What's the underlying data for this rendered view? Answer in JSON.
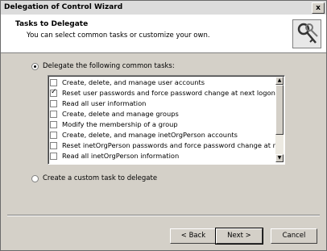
{
  "window": {
    "title": "Delegation of Control Wizard",
    "close": "x"
  },
  "header": {
    "title": "Tasks to Delegate",
    "subtitle": "You can select common tasks or customize your own."
  },
  "options": {
    "delegate_common": "Delegate the following common tasks:",
    "custom": "Create a custom task to delegate"
  },
  "tasks": [
    {
      "label": "Create, delete, and manage user accounts",
      "checked": false
    },
    {
      "label": "Reset user passwords and force password change at next logon",
      "checked": true
    },
    {
      "label": "Read all user information",
      "checked": false
    },
    {
      "label": "Create, delete and manage groups",
      "checked": false
    },
    {
      "label": "Modify the membership of a group",
      "checked": false
    },
    {
      "label": "Create, delete, and manage inetOrgPerson accounts",
      "checked": false
    },
    {
      "label": "Reset inetOrgPerson passwords and force password change at ne...",
      "checked": false
    },
    {
      "label": "Read all inetOrgPerson information",
      "checked": false
    }
  ],
  "buttons": {
    "back": "< Back",
    "next": "Next >",
    "cancel": "Cancel"
  },
  "icons": {
    "header": "keys-icon",
    "scroll_up": "arrow-up-icon",
    "scroll_down": "arrow-down-icon"
  }
}
